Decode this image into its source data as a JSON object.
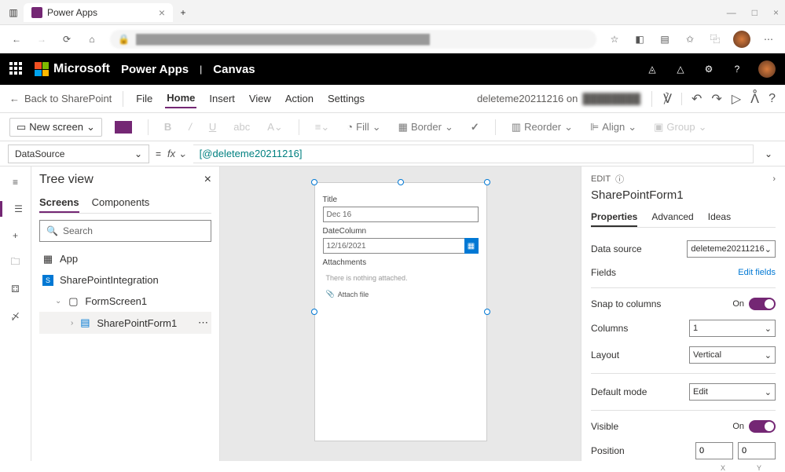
{
  "browser": {
    "tab_title": "Power Apps",
    "new_tab": "+",
    "minimize": "—",
    "maximize": "□",
    "close": "×"
  },
  "ms_header": {
    "brand": "Microsoft",
    "app": "Power Apps",
    "sep": "|",
    "context": "Canvas"
  },
  "cmd": {
    "back": "Back to SharePoint",
    "file": "File",
    "home": "Home",
    "insert": "Insert",
    "view": "View",
    "action": "Action",
    "settings": "Settings",
    "doc_name": "deleteme20211216 on",
    "undo": "↶",
    "redo": "↷",
    "play": "▷",
    "share": "ᐰ",
    "help": "?"
  },
  "ribbon": {
    "new_screen": "New screen",
    "fill": "Fill",
    "border": "Border",
    "reorder": "Reorder",
    "align": "Align",
    "group": "Group"
  },
  "formula": {
    "property": "DataSource",
    "eq": "=",
    "fx_label": "fx",
    "value": "[@deleteme20211216]"
  },
  "tree": {
    "title": "Tree view",
    "tab_screens": "Screens",
    "tab_components": "Components",
    "search_placeholder": "Search",
    "items": {
      "app": "App",
      "sp_integration": "SharePointIntegration",
      "form_screen": "FormScreen1",
      "sp_form": "SharePointForm1"
    }
  },
  "form": {
    "title_label": "Title",
    "title_value": "Dec 16",
    "date_label": "DateColumn",
    "date_value": "12/16/2021",
    "attachments_label": "Attachments",
    "nothing_attached": "There is nothing attached.",
    "attach_file": "Attach file"
  },
  "props": {
    "edit_label": "EDIT",
    "control_name": "SharePointForm1",
    "tab_properties": "Properties",
    "tab_advanced": "Advanced",
    "tab_ideas": "Ideas",
    "data_source_label": "Data source",
    "data_source_value": "deleteme20211216",
    "fields_label": "Fields",
    "edit_fields": "Edit fields",
    "snap_label": "Snap to columns",
    "snap_value": "On",
    "columns_label": "Columns",
    "columns_value": "1",
    "layout_label": "Layout",
    "layout_value": "Vertical",
    "default_mode_label": "Default mode",
    "default_mode_value": "Edit",
    "visible_label": "Visible",
    "visible_value": "On",
    "position_label": "Position",
    "position_x": "0",
    "position_y": "0",
    "x_label": "X",
    "y_label": "Y"
  }
}
